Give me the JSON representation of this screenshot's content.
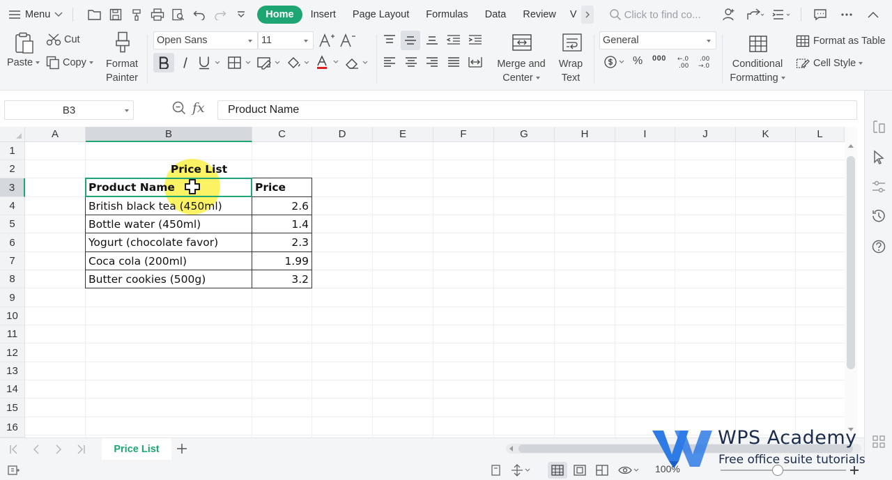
{
  "menubar": {
    "menu_label": "Menu",
    "tabs": [
      "Home",
      "Insert",
      "Page Layout",
      "Formulas",
      "Data",
      "Review",
      "V"
    ],
    "search_placeholder": "Click to find co..."
  },
  "ribbon": {
    "paste": "Paste",
    "cut": "Cut",
    "copy": "Copy",
    "format_painter_1": "Format",
    "format_painter_2": "Painter",
    "font_name": "Open Sans",
    "font_size": "11",
    "merge_1": "Merge and",
    "merge_2": "Center",
    "wrap_1": "Wrap",
    "wrap_2": "Text",
    "number_format": "General",
    "percent": "%",
    "thousands": "000",
    "dec_inc": "←.0\n.00",
    "dec_dec": ".00\n→.0",
    "cond_1": "Conditional",
    "cond_2": "Formatting",
    "format_table": "Format as Table",
    "cell_style": "Cell Style"
  },
  "formula_bar": {
    "name_box": "B3",
    "fx": "fx",
    "content": "Product Name"
  },
  "columns": [
    "A",
    "B",
    "C",
    "D",
    "E",
    "F",
    "G",
    "H",
    "I",
    "J",
    "K",
    "L"
  ],
  "rows": [
    "1",
    "2",
    "3",
    "4",
    "5",
    "6",
    "7",
    "8",
    "9",
    "10",
    "11",
    "12",
    "13",
    "14",
    "15",
    "16"
  ],
  "sheet": {
    "title": "Price List",
    "header": {
      "name": "Product Name",
      "price": "Price"
    },
    "items": [
      {
        "name": "British black tea (450ml)",
        "price": "2.6"
      },
      {
        "name": "Bottle water (450ml)",
        "price": "1.4"
      },
      {
        "name": "Yogurt (chocolate favor)",
        "price": "2.3"
      },
      {
        "name": "Coca cola (200ml)",
        "price": "1.99"
      },
      {
        "name": "Butter cookies (500g)",
        "price": "3.2"
      }
    ]
  },
  "sheet_tabs": {
    "active": "Price List",
    "add": "+"
  },
  "status": {
    "zoom": "100%"
  },
  "watermark": {
    "brand": "WPS Academy",
    "tagline": "Free office suite tutorials"
  },
  "colors": {
    "accent": "#1ea672",
    "highlight": "#faee28",
    "watermark": "#1a2b4b",
    "logo": "#2f7be6"
  }
}
